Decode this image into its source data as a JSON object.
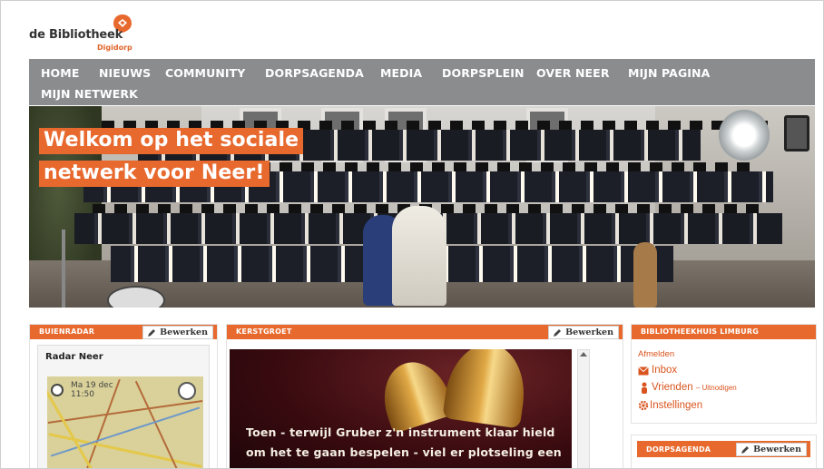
{
  "logo": {
    "name": "de Bibliotheek",
    "sub": "Digidorp"
  },
  "nav": {
    "items": [
      "HOME",
      "NIEUWS",
      "COMMUNITY",
      "DORPSAGENDA",
      "MEDIA",
      "DORPSPLEIN",
      "OVER NEER",
      "MIJN PAGINA",
      "MIJN NETWERK"
    ]
  },
  "hero": {
    "line1": "Welkom op het sociale",
    "line2": "netwerk voor Neer!"
  },
  "widgets": {
    "buienradar": {
      "title": "BUIENRADAR",
      "edit": "Bewerken",
      "radar_title": "Radar Neer",
      "date": "Ma 19 dec",
      "time": "11:50"
    },
    "kerstgroet": {
      "title": "KERSTGROET",
      "edit": "Bewerken",
      "text1": "Toen - terwijl Gruber z'n instrument klaar hield",
      "text2": "om het te gaan bespelen - viel er plotseling een"
    },
    "bibliotheekhuis": {
      "title": "BIBLIOTHEEKHUIS LIMBURG",
      "logout": "Afmelden",
      "inbox": "Inbox",
      "friends": "Vrienden",
      "invite": "– Uitnodigen",
      "settings": "Instellingen"
    },
    "dorpsagenda": {
      "title": "DORPSAGENDA",
      "edit": "Bewerken"
    }
  },
  "colors": {
    "accent": "#e8692e",
    "nav": "#8b8c8e",
    "link": "#d9541e"
  },
  "icons": {
    "edit": "pencil-icon",
    "inbox": "envelope-icon",
    "friends": "person-icon",
    "settings": "gear-icon"
  }
}
